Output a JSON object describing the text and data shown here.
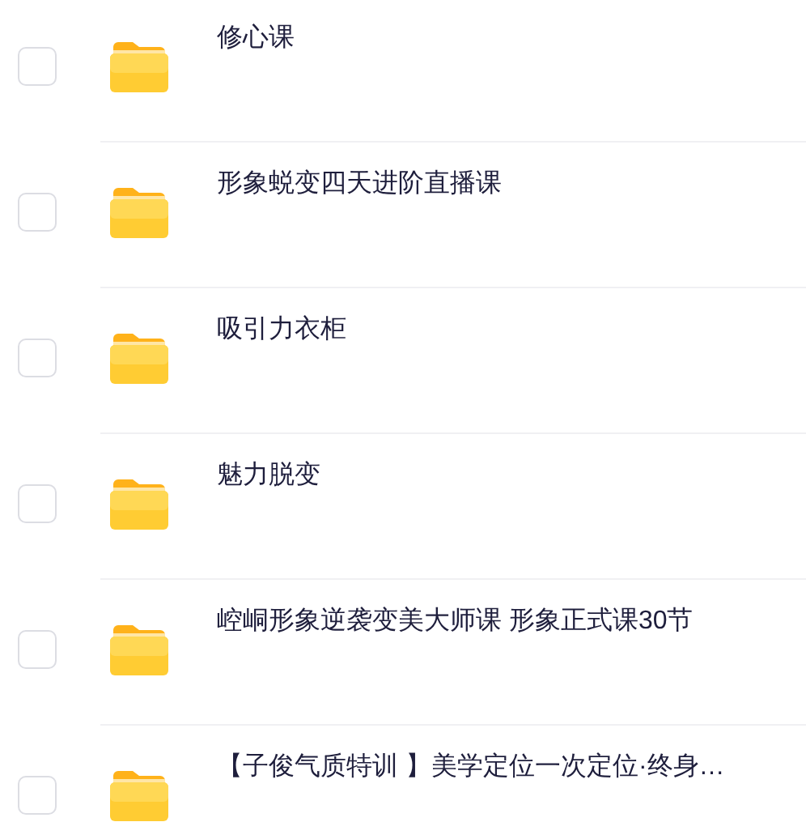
{
  "items": [
    {
      "name": "修心课",
      "checked": false
    },
    {
      "name": "形象蜕变四天进阶直播课",
      "checked": false
    },
    {
      "name": "吸引力衣柜",
      "checked": false
    },
    {
      "name": "魅力脱变",
      "checked": false
    },
    {
      "name": "崆峒形象逆袭变美大师课 形象正式课30节",
      "checked": false
    },
    {
      "name": "【子俊气质特训 】美学定位一次定位·终身…",
      "checked": false
    }
  ]
}
